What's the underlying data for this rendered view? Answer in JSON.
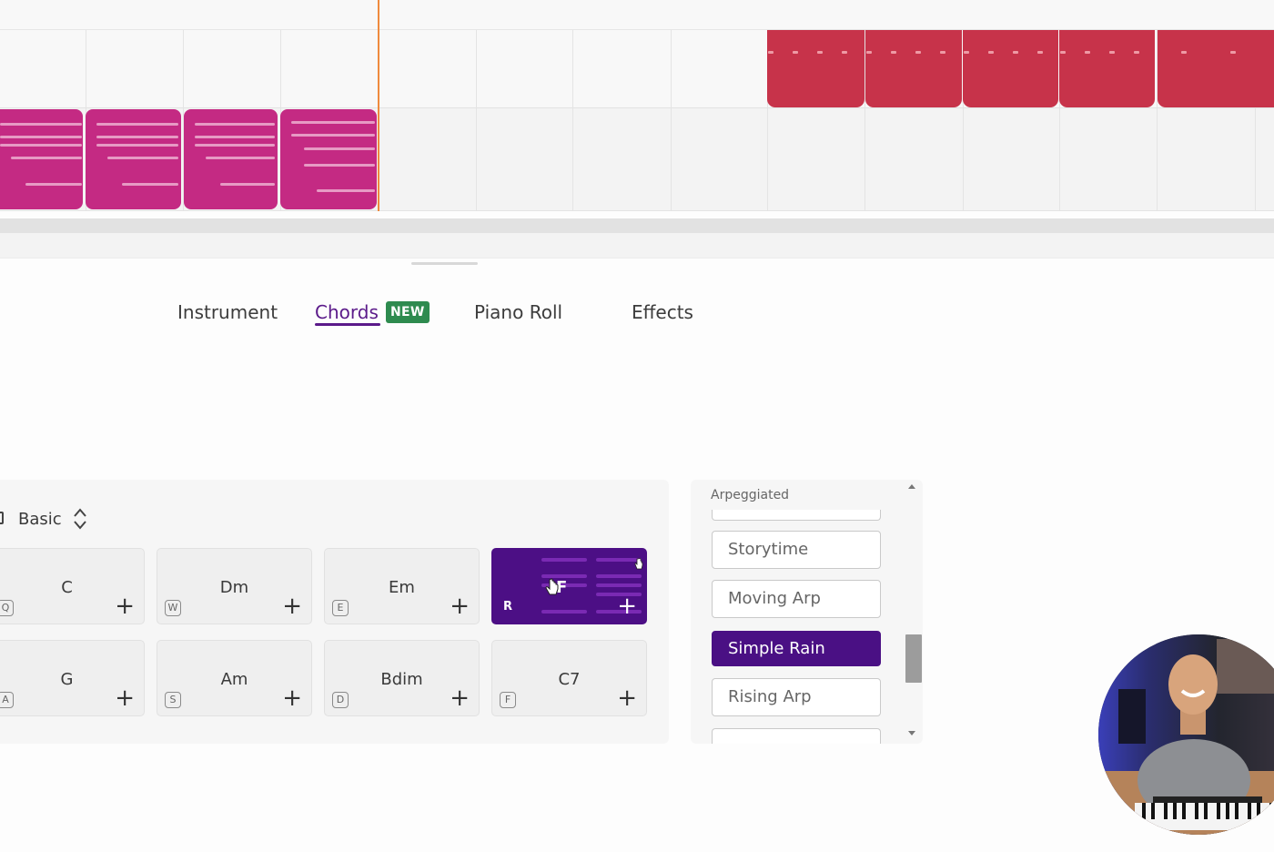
{
  "tabs": {
    "instrument": "Instrument",
    "chords": "Chords",
    "new_badge": "NEW",
    "piano_roll": "Piano Roll",
    "effects": "Effects",
    "active": "Chords"
  },
  "chord_set": {
    "label": "Basic"
  },
  "chords": [
    {
      "name": "C",
      "key": "Q"
    },
    {
      "name": "Dm",
      "key": "W"
    },
    {
      "name": "Em",
      "key": "E"
    },
    {
      "name": "F",
      "key": "R",
      "active": true
    },
    {
      "name": "G",
      "key": "A"
    },
    {
      "name": "Am",
      "key": "S"
    },
    {
      "name": "Bdim",
      "key": "D"
    },
    {
      "name": "C7",
      "key": "F"
    }
  ],
  "styles": {
    "category": "Arpeggiated",
    "items": [
      "Storytime",
      "Moving Arp",
      "Simple Rain",
      "Rising Arp"
    ],
    "selected": "Simple Rain"
  },
  "colors": {
    "accent": "#4c0f85",
    "chord_clip": "#c42a83",
    "drum_clip": "#c7334a",
    "playhead": "#ef8a3d",
    "new_badge": "#2e8b4f"
  },
  "icons": {
    "add": "plus-icon",
    "set_picker": "up-down-chevron-icon"
  }
}
